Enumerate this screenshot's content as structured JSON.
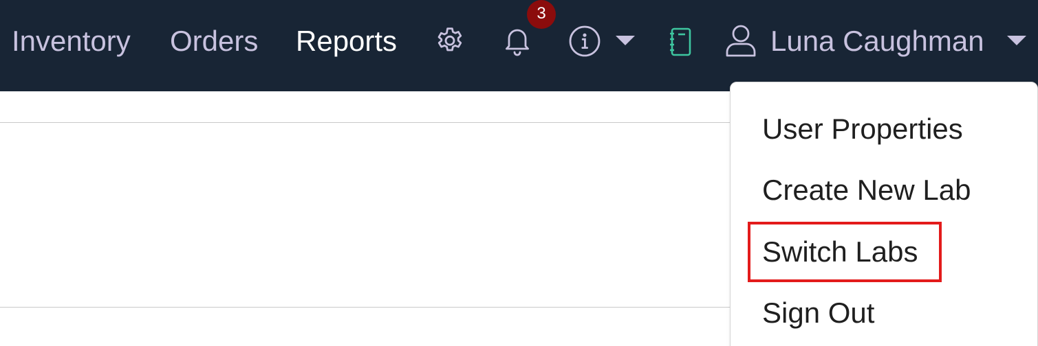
{
  "nav": {
    "links": [
      {
        "label": "Inventory"
      },
      {
        "label": "Orders"
      },
      {
        "label": "Reports"
      }
    ],
    "icons": {
      "settings": "gear-icon",
      "notifications": "bell-icon",
      "help": "info-icon",
      "notebook": "notebook-icon",
      "user": "user-icon",
      "caret": "caret-down-icon"
    },
    "notification_count": "3",
    "user_name": "Luna Caughman"
  },
  "user_menu": {
    "items": [
      {
        "label": "User Properties"
      },
      {
        "label": "Create New Lab"
      },
      {
        "label": "Switch Labs"
      },
      {
        "label": "Sign Out"
      }
    ]
  },
  "colors": {
    "navbar_bg": "#182535",
    "nav_text": "#c8c2df",
    "nav_active_text": "#ffffff",
    "badge_bg": "#8b0c0c",
    "notebook_icon": "#3ec7a0",
    "highlight": "#e31b1b"
  }
}
